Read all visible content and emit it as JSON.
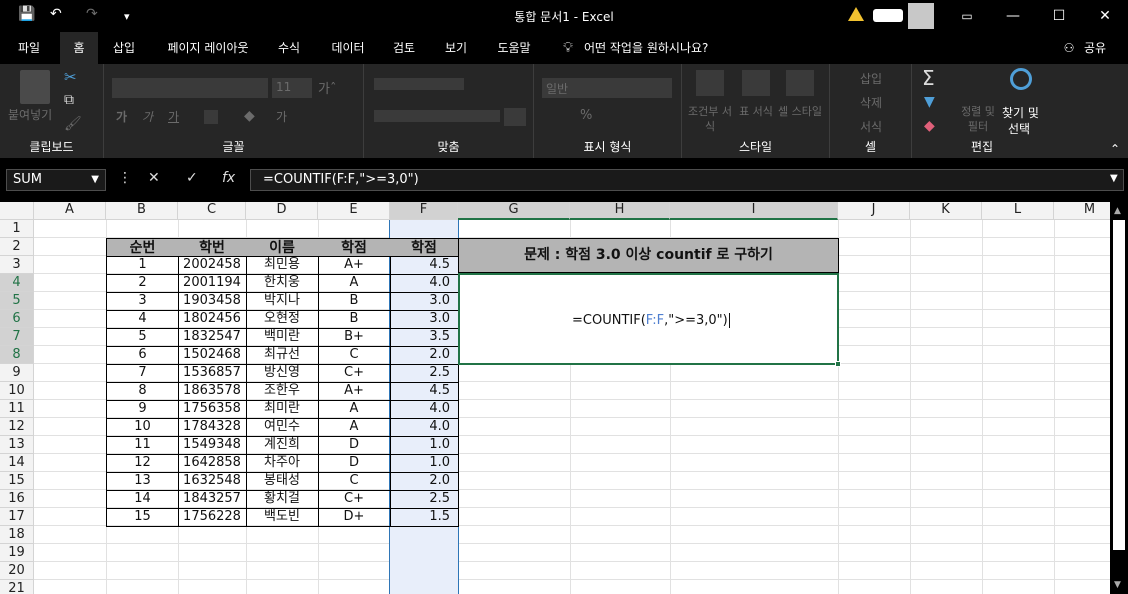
{
  "app": {
    "doc_title": "통합 문서1",
    "app_name": "Excel",
    "separator": "-"
  },
  "quick_access": {
    "save": "💾",
    "undo": "↶",
    "redo": "↷",
    "customize": "▾"
  },
  "menu": {
    "items": [
      "파일",
      "홈",
      "삽입",
      "페이지 레이아웃",
      "수식",
      "데이터",
      "검토",
      "보기",
      "도움말"
    ],
    "tell_me": "어떤 작업을 원하시나요?",
    "share": "공유"
  },
  "ribbon": {
    "clipboard": {
      "label": "클립보드",
      "paste": "붙여넣기"
    },
    "font": {
      "label": "글꼴",
      "size": "11",
      "bold": "가",
      "italic": "가",
      "underline": "가"
    },
    "align": {
      "label": "맞춤"
    },
    "number": {
      "label": "표시 형식",
      "format": "일반",
      "percent": "%"
    },
    "styles": {
      "label": "스타일",
      "cond": "조건부 서식",
      "table": "표 서식",
      "cell": "셀 스타일"
    },
    "cells": {
      "label": "셀",
      "insert": "삽입",
      "delete": "삭제",
      "format": "서식"
    },
    "edit": {
      "label": "편집",
      "sort": "정렬 및 필터",
      "find": "찾기 및",
      "select": "선택"
    }
  },
  "formula_bar": {
    "name_box": "SUM",
    "formula": "=COUNTIF(F:F,\">=3,0\")"
  },
  "columns": [
    "A",
    "B",
    "C",
    "D",
    "E",
    "F",
    "G",
    "H",
    "I",
    "J",
    "K",
    "L",
    "M"
  ],
  "rows": [
    "1",
    "2",
    "3",
    "4",
    "5",
    "6",
    "7",
    "8",
    "9",
    "10",
    "11",
    "12",
    "13",
    "14",
    "15",
    "16",
    "17",
    "18",
    "19",
    "20",
    "21"
  ],
  "table": {
    "headers": [
      "순번",
      "학번",
      "이름",
      "학점",
      "학점"
    ],
    "rows": [
      [
        "1",
        "2002458",
        "최민용",
        "A+",
        "4.5"
      ],
      [
        "2",
        "2001194",
        "한치웅",
        "A",
        "4.0"
      ],
      [
        "3",
        "1903458",
        "박지나",
        "B",
        "3.0"
      ],
      [
        "4",
        "1802456",
        "오현정",
        "B",
        "3.0"
      ],
      [
        "5",
        "1832547",
        "백미란",
        "B+",
        "3.5"
      ],
      [
        "6",
        "1502468",
        "최규선",
        "C",
        "2.0"
      ],
      [
        "7",
        "1536857",
        "방신영",
        "C+",
        "2.5"
      ],
      [
        "8",
        "1863578",
        "조한우",
        "A+",
        "4.5"
      ],
      [
        "9",
        "1756358",
        "최미란",
        "A",
        "4.0"
      ],
      [
        "10",
        "1784328",
        "여민수",
        "A",
        "4.0"
      ],
      [
        "11",
        "1549348",
        "계진희",
        "D",
        "1.0"
      ],
      [
        "12",
        "1642858",
        "차주아",
        "D",
        "1.0"
      ],
      [
        "13",
        "1632548",
        "봉태성",
        "C",
        "2.0"
      ],
      [
        "14",
        "1843257",
        "황치걸",
        "C+",
        "2.5"
      ],
      [
        "15",
        "1756228",
        "백도빈",
        "D+",
        "1.5"
      ]
    ]
  },
  "problem": {
    "title": "문제 : 학점 3.0 이상 countif 로 구하기",
    "formula_pre": "=COUNTIF(",
    "formula_ref": "F:F",
    "formula_post": ",\">=3,0\")"
  }
}
